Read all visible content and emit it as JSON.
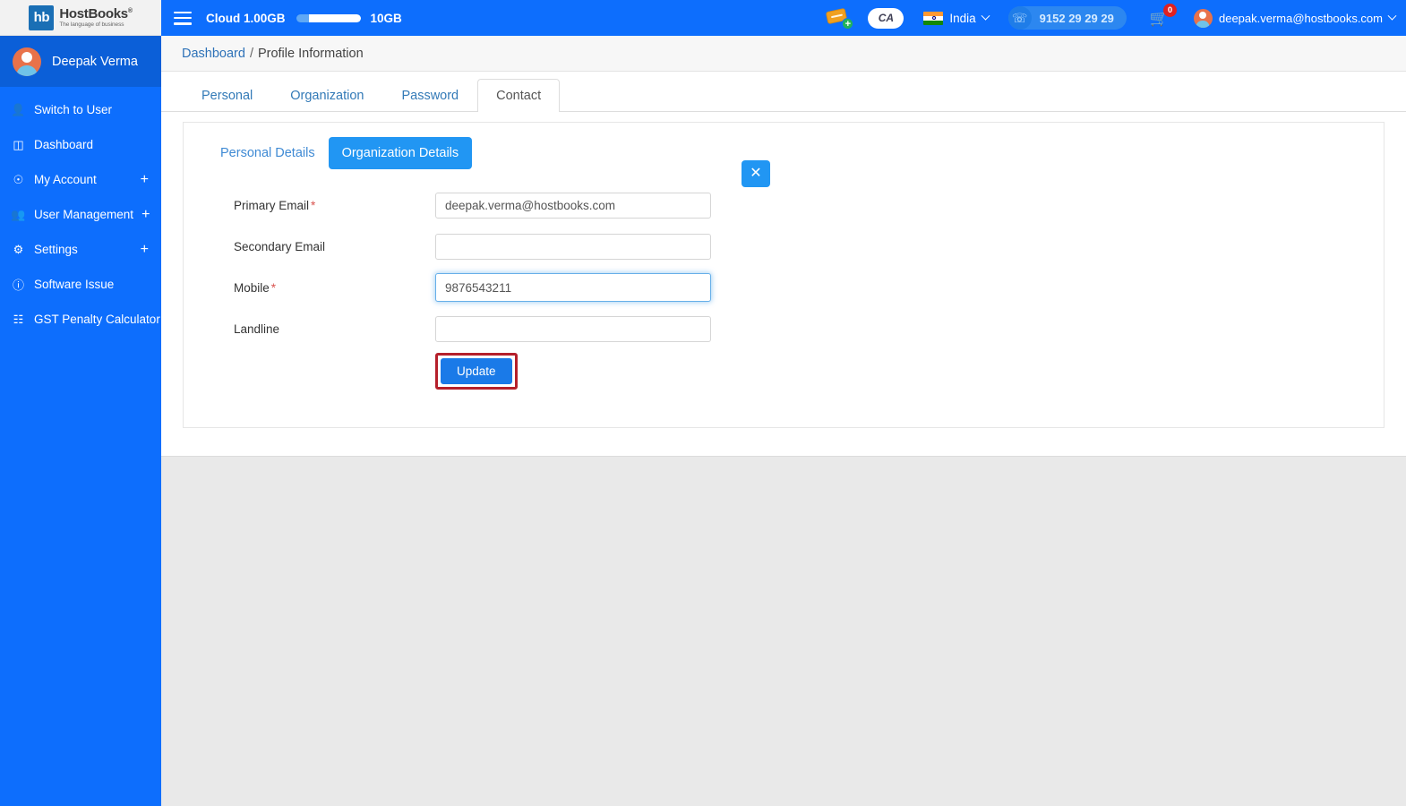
{
  "brand": {
    "logo_mark": "hb",
    "logo_title": "HostBooks",
    "logo_registered": "®",
    "logo_tagline": "The language of business"
  },
  "topbar": {
    "menu_icon": "hamburger-icon",
    "cloud_label": "Cloud 1.00GB",
    "cloud_max": "10GB",
    "cloud_used_percent": 10,
    "ticket_icon": "ticket-add-icon",
    "ca_badge": "CA",
    "country": "India",
    "country_caret": "chevron-down-icon",
    "phone": "9152 29 29 29",
    "phone_icon": "headset-icon",
    "cart_icon": "cart-icon",
    "cart_count": "0",
    "user_email": "deepak.verma@hostbooks.com",
    "user_caret": "chevron-down-icon",
    "accent": "#0d6efd"
  },
  "sidebar": {
    "profile_name": "Deepak Verma",
    "items": [
      {
        "label": "Switch to User",
        "icon": "user-icon",
        "expandable": false
      },
      {
        "label": "Dashboard",
        "icon": "dashboard-icon",
        "expandable": false
      },
      {
        "label": "My Account",
        "icon": "account-circle-icon",
        "expandable": true,
        "expand_glyph": "+"
      },
      {
        "label": "User Management",
        "icon": "users-group-icon",
        "expandable": true,
        "expand_glyph": "+"
      },
      {
        "label": "Settings",
        "icon": "gear-icon",
        "expandable": true,
        "expand_glyph": "+"
      },
      {
        "label": "Software Issue",
        "icon": "info-icon",
        "expandable": false
      },
      {
        "label": "GST Penalty Calculator",
        "icon": "calculator-icon",
        "expandable": false
      }
    ]
  },
  "breadcrumb": {
    "root": "Dashboard",
    "separator": "/",
    "current": "Profile Information"
  },
  "tabs": [
    {
      "label": "Personal",
      "active": false
    },
    {
      "label": "Organization",
      "active": false
    },
    {
      "label": "Password",
      "active": false
    },
    {
      "label": "Contact",
      "active": true
    }
  ],
  "subtabs": [
    {
      "label": "Personal Details",
      "active": false
    },
    {
      "label": "Organization Details",
      "active": true
    }
  ],
  "close_button": {
    "icon": "close-icon",
    "glyph": "✕"
  },
  "form": {
    "fields": [
      {
        "label": "Primary Email",
        "required": true,
        "value": "deepak.verma@hostbooks.com",
        "placeholder": "",
        "focused": false
      },
      {
        "label": "Secondary Email",
        "required": false,
        "value": "",
        "placeholder": "",
        "focused": false
      },
      {
        "label": "Mobile",
        "required": true,
        "value": "9876543211",
        "placeholder": "",
        "focused": true
      },
      {
        "label": "Landline",
        "required": false,
        "value": "",
        "placeholder": "",
        "focused": false
      }
    ],
    "required_marker": "*",
    "submit_label": "Update",
    "submit_highlight_color": "#b5202b"
  }
}
